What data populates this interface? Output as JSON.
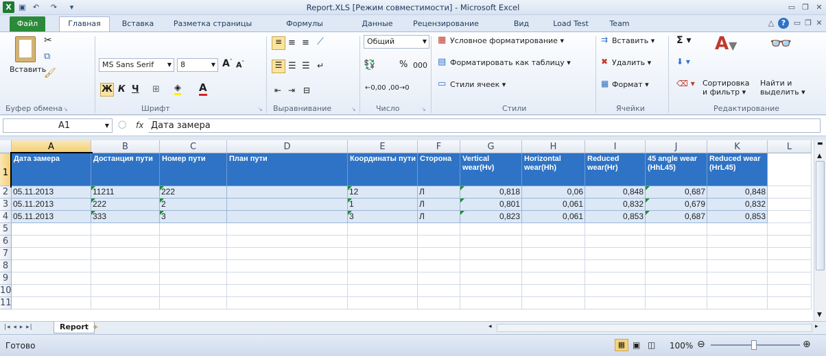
{
  "window": {
    "title": "Report.XLS  [Режим совместимости]  -  Microsoft Excel"
  },
  "tabs": [
    "Файл",
    "Главная",
    "Вставка",
    "Разметка страницы",
    "Формулы",
    "Данные",
    "Рецензирование",
    "Вид",
    "Load Test",
    "Team"
  ],
  "ribbon": {
    "clipboard": {
      "paste": "Вставить",
      "label": "Буфер обмена"
    },
    "font": {
      "name": "MS Sans Serif",
      "size": "8",
      "bold": "Ж",
      "italic": "К",
      "underline": "Ч",
      "label": "Шрифт"
    },
    "align": {
      "label": "Выравнивание"
    },
    "number": {
      "format": "Общий",
      "pct": "%",
      "thousands": "000",
      "label": "Число"
    },
    "styles": {
      "cond": "Условное форматирование",
      "table": "Форматировать как таблицу",
      "cell": "Стили ячеек",
      "label": "Стили"
    },
    "cells": {
      "insert": "Вставить",
      "delete": "Удалить",
      "format": "Формат",
      "label": "Ячейки"
    },
    "editing": {
      "sort1": "Сортировка",
      "sort2": "и фильтр",
      "find1": "Найти и",
      "find2": "выделить",
      "label": "Редактирование"
    }
  },
  "formula_bar": {
    "name_box": "A1",
    "fx": "fx",
    "value": "Дата замера"
  },
  "columns": [
    "A",
    "B",
    "C",
    "D",
    "E",
    "F",
    "G",
    "H",
    "I",
    "J",
    "K",
    "L"
  ],
  "rows": [
    "1",
    "2",
    "3",
    "4",
    "5",
    "6",
    "7",
    "8",
    "9",
    "10",
    "11"
  ],
  "header": [
    "Дата замера",
    "Достанция пути",
    "Номер пути",
    "План пути",
    "Координаты пути",
    "Сторона",
    "Vertical wear(Hv)",
    "Horizontal wear(Hh)",
    "Reduced wear(Hr)",
    "45 angle wear (HhL45)",
    "Reduced wear (HrL45)"
  ],
  "data": [
    [
      "05.11.2013",
      "11211",
      "222",
      "",
      "12",
      "Л",
      "0,818",
      "0,06",
      "0,848",
      "0,687",
      "0,848"
    ],
    [
      "05.11.2013",
      "222",
      "2",
      "",
      "1",
      "Л",
      "0,801",
      "0,061",
      "0,832",
      "0,679",
      "0,832"
    ],
    [
      "05.11.2013",
      "333",
      "3",
      "",
      "3",
      "Л",
      "0,823",
      "0,061",
      "0,853",
      "0,687",
      "0,853"
    ]
  ],
  "sheet_tab": "Report",
  "status": {
    "ready": "Готово",
    "zoom": "100%"
  }
}
